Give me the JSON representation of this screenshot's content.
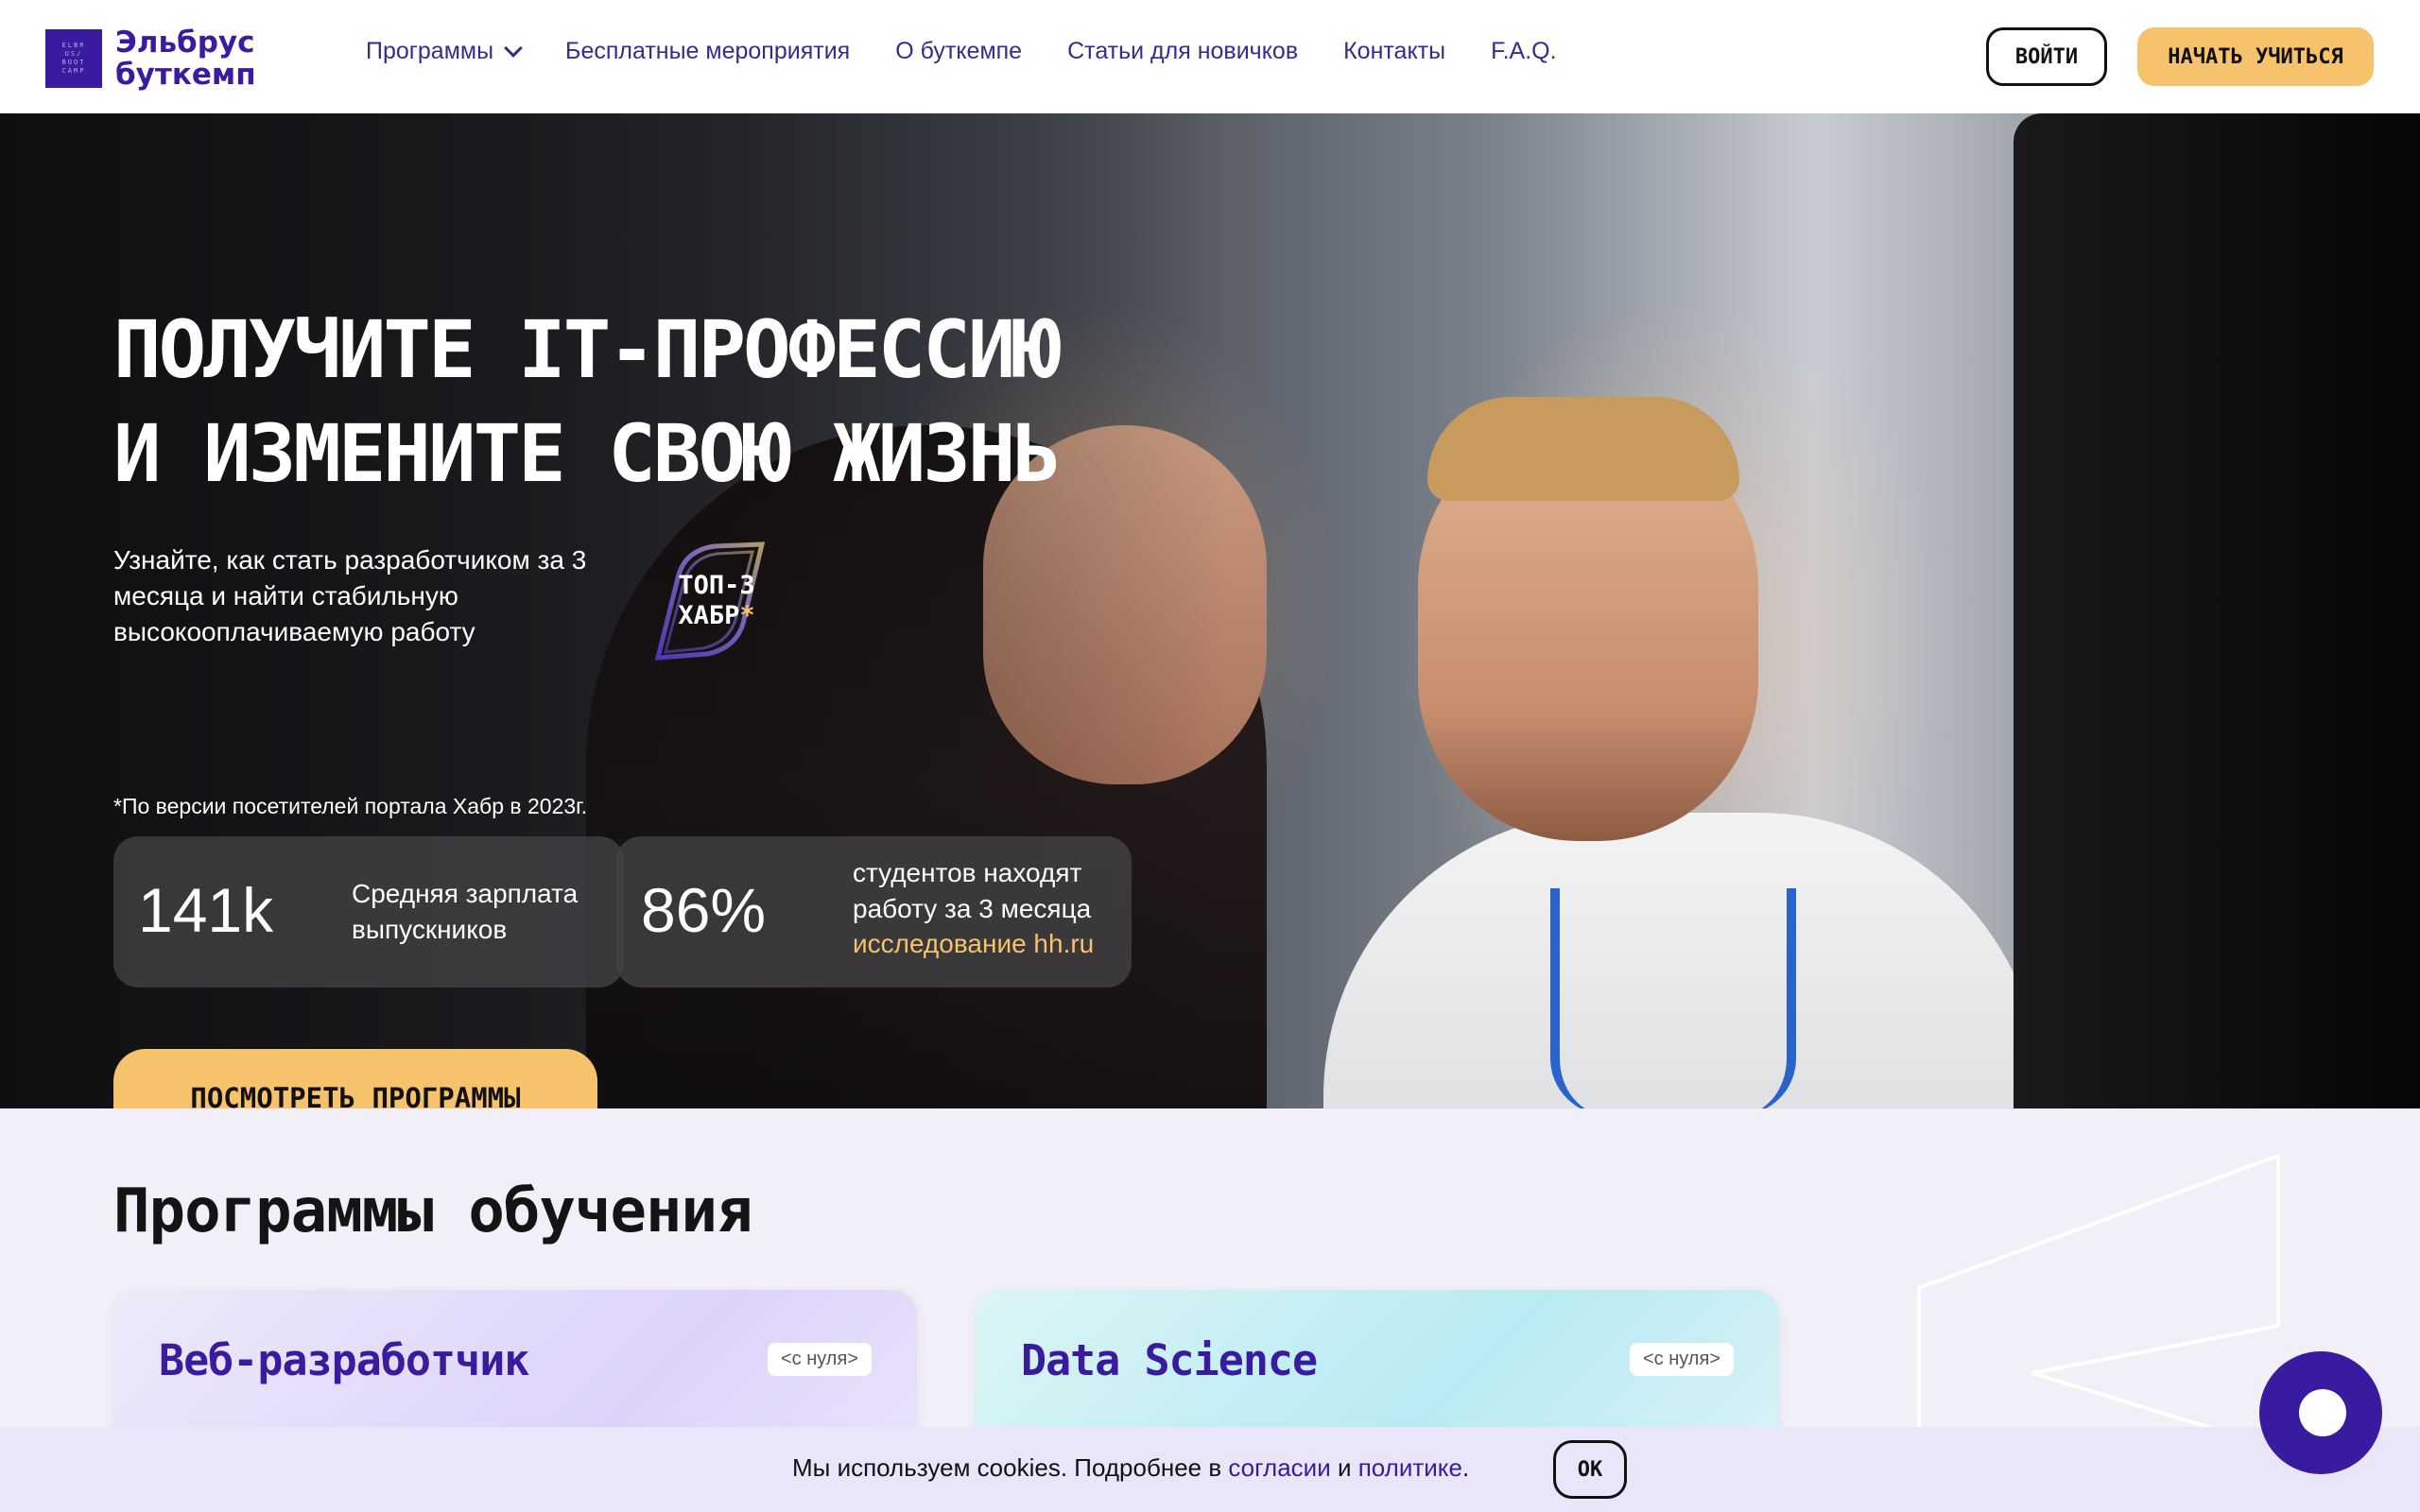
{
  "header": {
    "logo_line1": "Эльбрус",
    "logo_line2": "буткемп",
    "logo_badge": [
      "ELBR",
      "US/",
      "BOOT",
      "CAMP"
    ],
    "nav": [
      {
        "label": "Программы",
        "has_dropdown": true
      },
      {
        "label": "Бесплатные мероприятия"
      },
      {
        "label": "О буткемпе"
      },
      {
        "label": "Статьи для новичков"
      },
      {
        "label": "Контакты"
      },
      {
        "label": "F.A.Q."
      }
    ],
    "login_label": "ВОЙТИ",
    "start_label": "НАЧАТЬ УЧИТЬСЯ"
  },
  "hero": {
    "title_line1": "ПОЛУЧИТЕ IT-ПРОФЕССИЮ",
    "title_line2": "И ИЗМЕНИТЕ СВОЮ ЖИЗНЬ",
    "subtitle": "Узнайте, как стать разработчиком за 3 месяца и найти стабильную высокооплачиваемую работу",
    "badge_line1": "ТОП-3",
    "badge_line2": "ХАБР",
    "badge_star": "*",
    "footnote": "*По версии посетителей портала Хабр в 2023г.",
    "stats": [
      {
        "value": "141k",
        "label": "Средняя зарплата выпускников"
      },
      {
        "value": "86%",
        "label": "студентов находят работу за 3 месяца",
        "link": "исследование hh.ru"
      }
    ],
    "cta_label": "ПОСМОТРЕТЬ ПРОГРАММЫ"
  },
  "programs": {
    "title": "Программы обучения",
    "cards": [
      {
        "title": "Веб-разработчик",
        "tag": "<с нуля>"
      },
      {
        "title": "Data Science",
        "tag": "<с нуля>"
      }
    ]
  },
  "cookie": {
    "text_before": "Мы используем cookies. Подробнее в ",
    "link1": "согласии",
    "text_mid": " и ",
    "link2": "политике",
    "text_after": ".",
    "ok_label": "OK"
  },
  "colors": {
    "brand": "#3a1a9e",
    "accent": "#f6c26b",
    "section_bg": "#f1eff7"
  },
  "icons": {
    "chat": "chat-bubble-icon",
    "dropdown": "chevron-down-icon"
  }
}
